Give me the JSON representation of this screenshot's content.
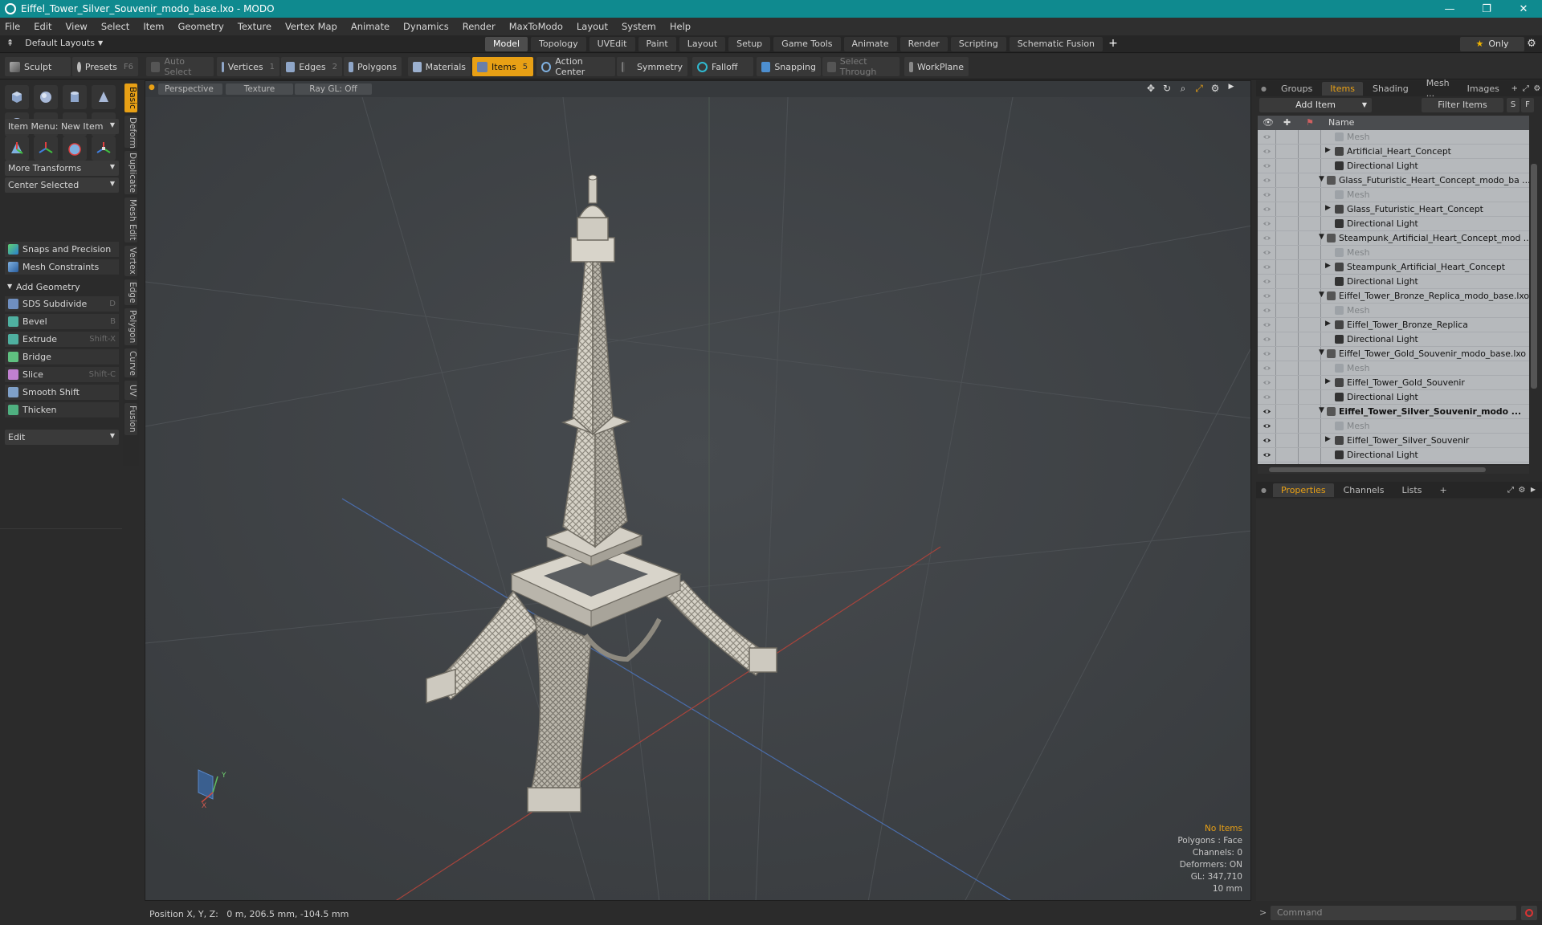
{
  "window": {
    "title": "Eiffel_Tower_Silver_Souvenir_modo_base.lxo - MODO",
    "controls": [
      "—",
      "❐",
      "✕"
    ]
  },
  "menu": [
    "File",
    "Edit",
    "View",
    "Select",
    "Item",
    "Geometry",
    "Texture",
    "Vertex Map",
    "Animate",
    "Dynamics",
    "Render",
    "MaxToModo",
    "Layout",
    "System",
    "Help"
  ],
  "layoutbar": {
    "default_layouts": "Default Layouts",
    "tabs": [
      "Model",
      "Topology",
      "UVEdit",
      "Paint",
      "Layout",
      "Setup",
      "Game Tools",
      "Animate",
      "Render",
      "Scripting",
      "Schematic Fusion"
    ],
    "active_tab": "Model",
    "add_symbol": "+",
    "only_label": "Only"
  },
  "toolbar": {
    "sculpt": "Sculpt",
    "presets": "Presets",
    "presets_key": "F6",
    "auto_select": "Auto Select",
    "vertices": "Vertices",
    "vertices_key": "1",
    "edges": "Edges",
    "edges_key": "2",
    "polygons": "Polygons",
    "materials": "Materials",
    "items": "Items",
    "items_key": "5",
    "action_center": "Action Center",
    "symmetry": "Symmetry",
    "falloff": "Falloff",
    "snapping": "Snapping",
    "select_through": "Select Through",
    "workplane": "WorkPlane"
  },
  "leftpanel": {
    "item_menu": "Item Menu: New Item",
    "more_transforms": "More Transforms",
    "center_selected": "Center Selected",
    "snaps": "Snaps and Precision",
    "mesh_constraints": "Mesh Constraints",
    "add_geometry": "Add Geometry",
    "tools": [
      {
        "label": "SDS Subdivide",
        "key": "D"
      },
      {
        "label": "Bevel",
        "key": "B"
      },
      {
        "label": "Extrude",
        "key": "Shift-X"
      },
      {
        "label": "Bridge",
        "key": ""
      },
      {
        "label": "Slice",
        "key": "Shift-C"
      },
      {
        "label": "Smooth Shift",
        "key": ""
      },
      {
        "label": "Thicken",
        "key": ""
      }
    ],
    "edit": "Edit",
    "sidetabs": [
      "Basic",
      "Deform",
      "Duplicate",
      "Mesh Edit",
      "Vertex",
      "Edge",
      "Polygon",
      "Curve",
      "UV",
      "Fusion"
    ]
  },
  "viewport": {
    "perspective": "Perspective",
    "texture": "Texture",
    "raygl": "Ray GL: Off",
    "info": {
      "no_items": "No Items",
      "polygons": "Polygons : Face",
      "channels": "Channels: 0",
      "deformers": "Deformers: ON",
      "gl": "GL: 347,710",
      "scale": "10 mm"
    },
    "axis_y": "Y",
    "axis_x": "X"
  },
  "statusbar": {
    "position": "Position X, Y, Z:   0 m, 206.5 mm, -104.5 mm"
  },
  "rightpanel": {
    "tabs": [
      "Groups",
      "Items",
      "Shading",
      "Mesh ...",
      "Images"
    ],
    "active_tab": "Items",
    "add_item": "Add Item",
    "filter_items": "Filter Items",
    "s_btn": "S",
    "f_btn": "F",
    "name_col": "Name",
    "tree": [
      {
        "label": "Mesh",
        "type": "mesh",
        "indent": 2,
        "visible": false
      },
      {
        "label": "Artificial_Heart_Concept",
        "type": "group",
        "indent": 2,
        "visible": false
      },
      {
        "label": "Directional Light",
        "type": "light",
        "indent": 2,
        "visible": false
      },
      {
        "label": "Glass_Futuristic_Heart_Concept_modo_ba ...",
        "type": "scene",
        "indent": 1,
        "visible": false
      },
      {
        "label": "Mesh",
        "type": "mesh",
        "indent": 2,
        "visible": false
      },
      {
        "label": "Glass_Futuristic_Heart_Concept",
        "type": "group",
        "indent": 2,
        "visible": false
      },
      {
        "label": "Directional Light",
        "type": "light",
        "indent": 2,
        "visible": false
      },
      {
        "label": "Steampunk_Artificial_Heart_Concept_mod ...",
        "type": "scene",
        "indent": 1,
        "visible": false
      },
      {
        "label": "Mesh",
        "type": "mesh",
        "indent": 2,
        "visible": false
      },
      {
        "label": "Steampunk_Artificial_Heart_Concept",
        "type": "group",
        "indent": 2,
        "visible": false
      },
      {
        "label": "Directional Light",
        "type": "light",
        "indent": 2,
        "visible": false
      },
      {
        "label": "Eiffel_Tower_Bronze_Replica_modo_base.lxo",
        "type": "scene",
        "indent": 1,
        "visible": false
      },
      {
        "label": "Mesh",
        "type": "mesh",
        "indent": 2,
        "visible": false
      },
      {
        "label": "Eiffel_Tower_Bronze_Replica",
        "type": "group",
        "indent": 2,
        "visible": false
      },
      {
        "label": "Directional Light",
        "type": "light",
        "indent": 2,
        "visible": false
      },
      {
        "label": "Eiffel_Tower_Gold_Souvenir_modo_base.lxo",
        "type": "scene",
        "indent": 1,
        "visible": false
      },
      {
        "label": "Mesh",
        "type": "mesh",
        "indent": 2,
        "visible": false
      },
      {
        "label": "Eiffel_Tower_Gold_Souvenir",
        "type": "group",
        "indent": 2,
        "visible": false
      },
      {
        "label": "Directional Light",
        "type": "light",
        "indent": 2,
        "visible": false
      },
      {
        "label": "Eiffel_Tower_Silver_Souvenir_modo ...",
        "type": "scene",
        "indent": 1,
        "visible": true,
        "bold": true
      },
      {
        "label": "Mesh",
        "type": "mesh",
        "indent": 2,
        "visible": true
      },
      {
        "label": "Eiffel_Tower_Silver_Souvenir",
        "type": "group",
        "indent": 2,
        "visible": true
      },
      {
        "label": "Directional Light",
        "type": "light",
        "indent": 2,
        "visible": true
      }
    ],
    "props_tabs": [
      "Properties",
      "Channels",
      "Lists"
    ],
    "props_active": "Properties",
    "props_add": "+",
    "command_placeholder": "Command",
    "command_prompt": ">"
  },
  "colors": {
    "accent": "#e8a015",
    "titlebar": "#0f8a8f",
    "viewport_bg": "#404448",
    "tree_bg": "#b6b9bc",
    "model_color": "#cfccc2"
  }
}
